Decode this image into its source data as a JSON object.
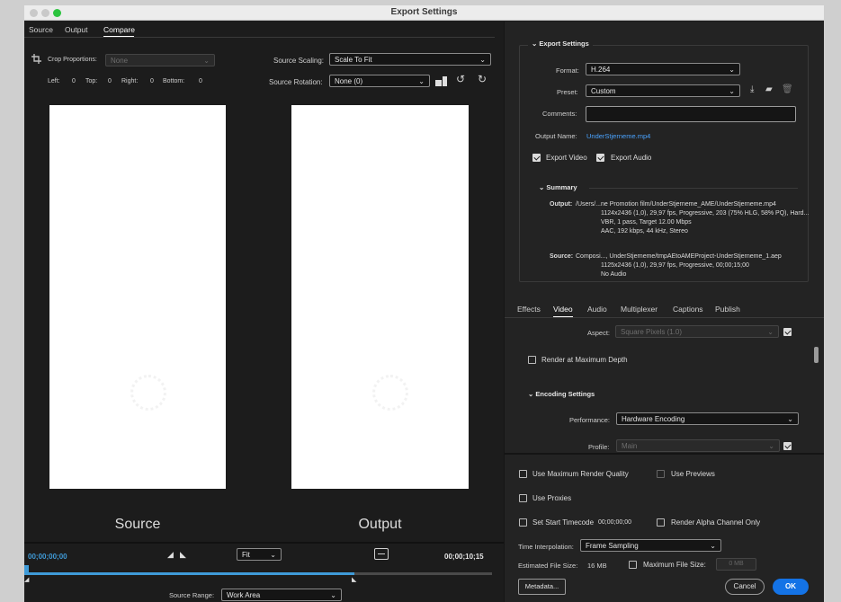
{
  "window": {
    "title": "Export Settings"
  },
  "left_tabs": [
    {
      "label": "Source"
    },
    {
      "label": "Output"
    },
    {
      "label": "Compare"
    }
  ],
  "crop": {
    "label": "Crop Proportions:",
    "value": "None",
    "left_label": "Left:",
    "left": "0",
    "top_label": "Top:",
    "top": "0",
    "right_label": "Right:",
    "right": "0",
    "bottom_label": "Bottom:",
    "bottom": "0"
  },
  "source_scaling": {
    "label": "Source Scaling:",
    "value": "Scale To Fit"
  },
  "source_rotation": {
    "label": "Source Rotation:",
    "value": "None (0)"
  },
  "preview": {
    "source_label": "Source",
    "output_label": "Output"
  },
  "timeline": {
    "start_timecode": "00;00;00;00",
    "end_timecode": "00;00;10;15",
    "zoom": "Fit",
    "source_range_label": "Source Range:",
    "source_range_value": "Work Area",
    "playhead_fraction": 0.0,
    "work_area_end_fraction": 0.705
  },
  "export_settings": {
    "section_label": "Export Settings",
    "format_label": "Format:",
    "format_value": "H.264",
    "preset_label": "Preset:",
    "preset_value": "Custom",
    "comments_label": "Comments:",
    "comments_value": "",
    "output_name_label": "Output Name:",
    "output_name_value": "UnderStjerneme.mp4",
    "export_video_label": "Export Video",
    "export_video_checked": true,
    "export_audio_label": "Export Audio",
    "export_audio_checked": true
  },
  "summary": {
    "section_label": "Summary",
    "output_label": "Output:",
    "output_lines": [
      "/Users/...ne Promotion film/UnderStjerneme_AME/UnderStjerneme.mp4",
      "1124x2436 (1,0), 29,97 fps, Progressive, 203 (75% HLG, 58% PQ), Hard...",
      "VBR, 1 pass, Target 12.00 Mbps",
      "AAC, 192 kbps, 44 kHz, Stereo"
    ],
    "source_label": "Source:",
    "source_lines": [
      "Composi..., UnderStjerneme/tmpAEtoAMEProject-UnderStjerneme_1.aep",
      "1125x2436 (1,0), 29,97 fps, Progressive, 00;00;15;00",
      "No Audio"
    ]
  },
  "right_tabs": [
    {
      "label": "Effects"
    },
    {
      "label": "Video"
    },
    {
      "label": "Audio"
    },
    {
      "label": "Multiplexer"
    },
    {
      "label": "Captions"
    },
    {
      "label": "Publish"
    }
  ],
  "video": {
    "aspect_label": "Aspect:",
    "aspect_value": "Square Pixels (1.0)",
    "render_max_depth_label": "Render at Maximum Depth",
    "encoding_section_label": "Encoding Settings",
    "performance_label": "Performance:",
    "performance_value": "Hardware Encoding",
    "profile_label": "Profile:",
    "profile_value": "Main"
  },
  "bottom": {
    "max_render_quality_label": "Use Maximum Render Quality",
    "use_previews_label": "Use Previews",
    "use_proxies_label": "Use Proxies",
    "set_start_timecode_label": "Set Start Timecode",
    "start_timecode_value": "00;00;00;00",
    "render_alpha_label": "Render Alpha Channel Only",
    "time_interp_label": "Time Interpolation:",
    "time_interp_value": "Frame Sampling",
    "est_file_size_label": "Estimated File Size:",
    "est_file_size_value": "16 MB",
    "max_file_size_label": "Maximum File Size:",
    "max_file_size_value": "0 MB",
    "metadata_label": "Metadata...",
    "cancel_label": "Cancel",
    "ok_label": "OK"
  },
  "colors": {
    "accent": "#1473e6",
    "link": "#4aa3ff",
    "timeline_bar": "#3f9bd8",
    "panel": "#232323"
  }
}
